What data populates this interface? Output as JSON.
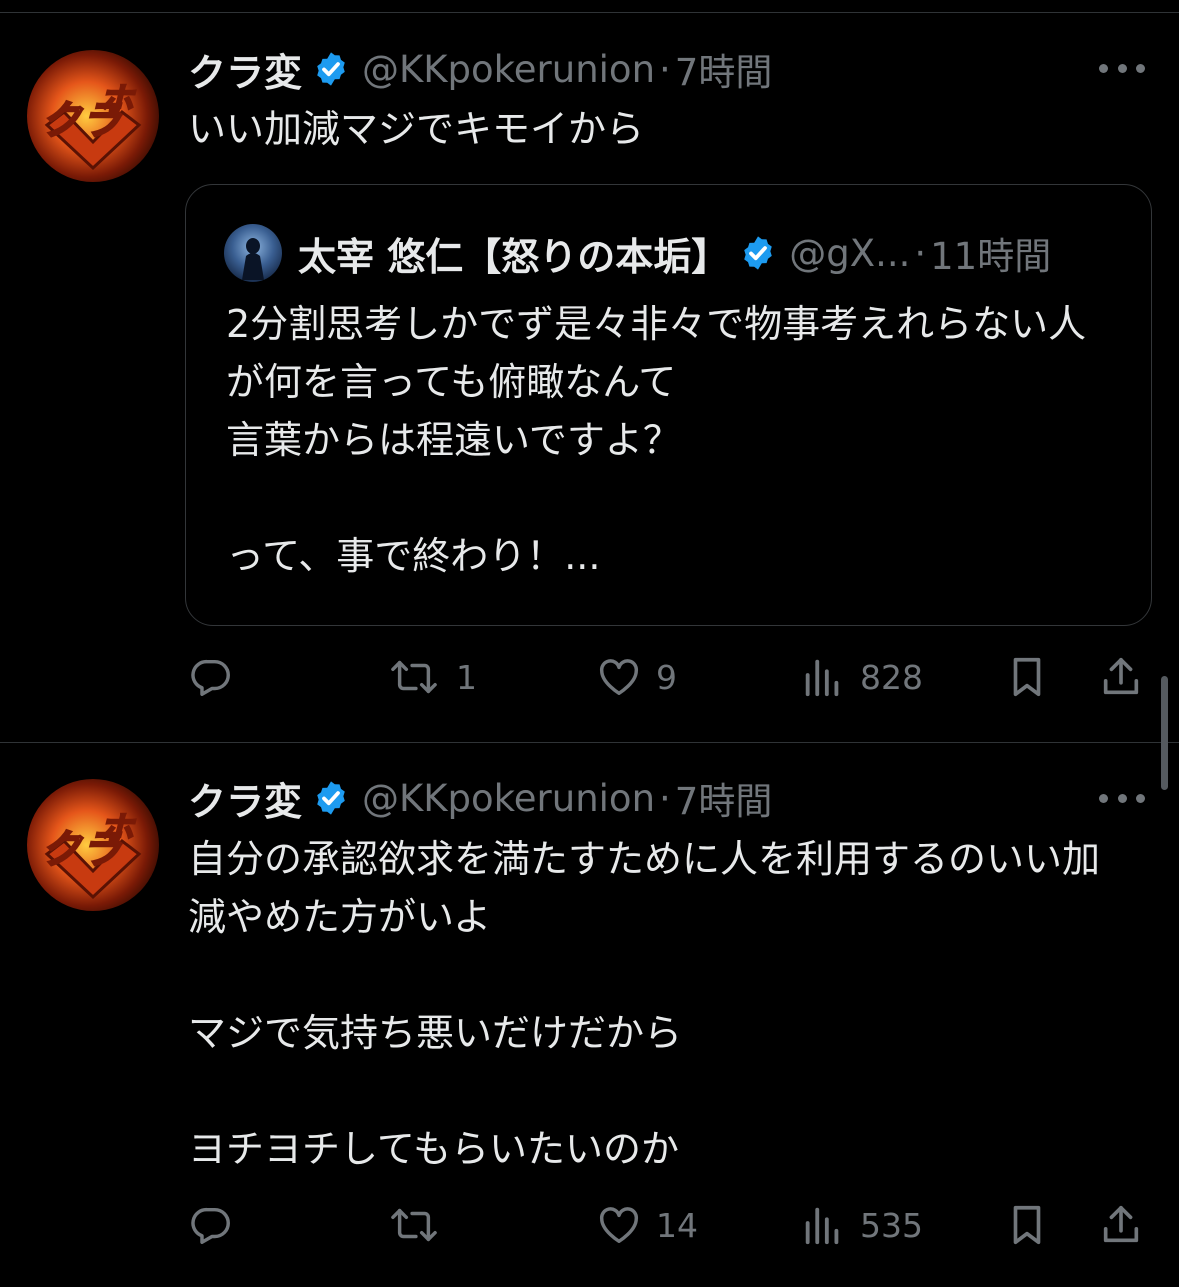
{
  "tweets": [
    {
      "name": "クラ変",
      "handle": "@KKpokerunion",
      "separator": "·",
      "time": "7時間",
      "text": "いい加減マジでキモイから",
      "quote": {
        "name": "太宰 悠仁【怒りの本垢】",
        "handle": "@gX...",
        "separator": "·",
        "time": "11時間",
        "text": "2分割思考しかでず是々非々で物事考えれらない人が何を言っても俯瞰なんて\n言葉からは程遠いですよ？\n\nって、事で終わり！..."
      },
      "stats": {
        "replies": "",
        "reposts": "1",
        "likes": "9",
        "views": "828"
      }
    },
    {
      "name": "クラ変",
      "handle": "@KKpokerunion",
      "separator": "·",
      "time": "7時間",
      "text": "自分の承認欲求を満たすために人を利用するのいい加減やめた方がいよ\n\nマジで気持ち悪いだけだから\n\nヨチヨチしてもらいたいのか",
      "stats": {
        "replies": "",
        "reposts": "",
        "likes": "14",
        "views": "535"
      }
    }
  ],
  "icons": [
    "verified-badge-icon",
    "more-icon",
    "reply-icon",
    "repost-icon",
    "like-icon",
    "views-icon",
    "bookmark-icon",
    "share-icon"
  ],
  "colors": {
    "background": "#000000",
    "text": "#e7e9ea",
    "secondary": "#71767b",
    "verified": "#1d9bf0",
    "divider": "#2f3336"
  }
}
